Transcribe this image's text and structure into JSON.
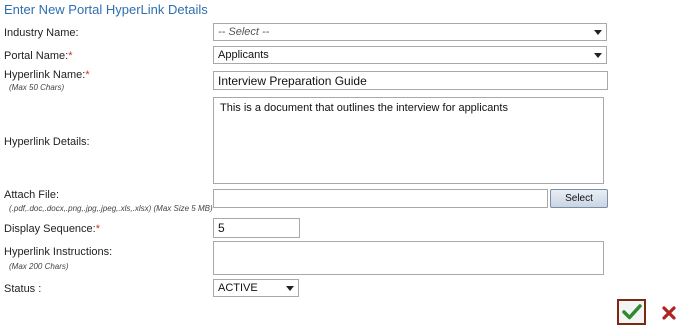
{
  "form": {
    "title": "Enter New Portal HyperLink Details",
    "industry_name": {
      "label": "Industry Name:",
      "value": "-- Select --"
    },
    "portal_name": {
      "label": "Portal Name:",
      "required": "*",
      "value": "Applicants"
    },
    "hyperlink_name": {
      "label": "Hyperlink Name:",
      "required": "*",
      "hint": "(Max 50 Chars)",
      "value": "Interview Preparation Guide"
    },
    "hyperlink_details": {
      "label": "Hyperlink Details:",
      "value": "This is a document that outlines the interview for applicants"
    },
    "attach_file": {
      "label": "Attach File:",
      "hint": "(.pdf,.doc,.docx,.png,.jpg,.jpeg,.xls,.xlsx) (Max Size 5 MB)",
      "value": "",
      "button": "Select"
    },
    "display_sequence": {
      "label": "Display Sequence:",
      "required": "*",
      "value": "5"
    },
    "hyperlink_instructions": {
      "label": "Hyperlink Instructions:",
      "hint": "(Max 200 Chars)",
      "value": ""
    },
    "status": {
      "label": "Status :",
      "value": "ACTIVE"
    }
  },
  "colors": {
    "title": "#2e6fb0",
    "required": "#c0392b",
    "save_check": "#2e8b2e",
    "cancel_x": "#b22222"
  },
  "icons": {
    "save": "checkmark-icon",
    "cancel": "x-icon",
    "dropdown": "chevron-down-icon"
  }
}
